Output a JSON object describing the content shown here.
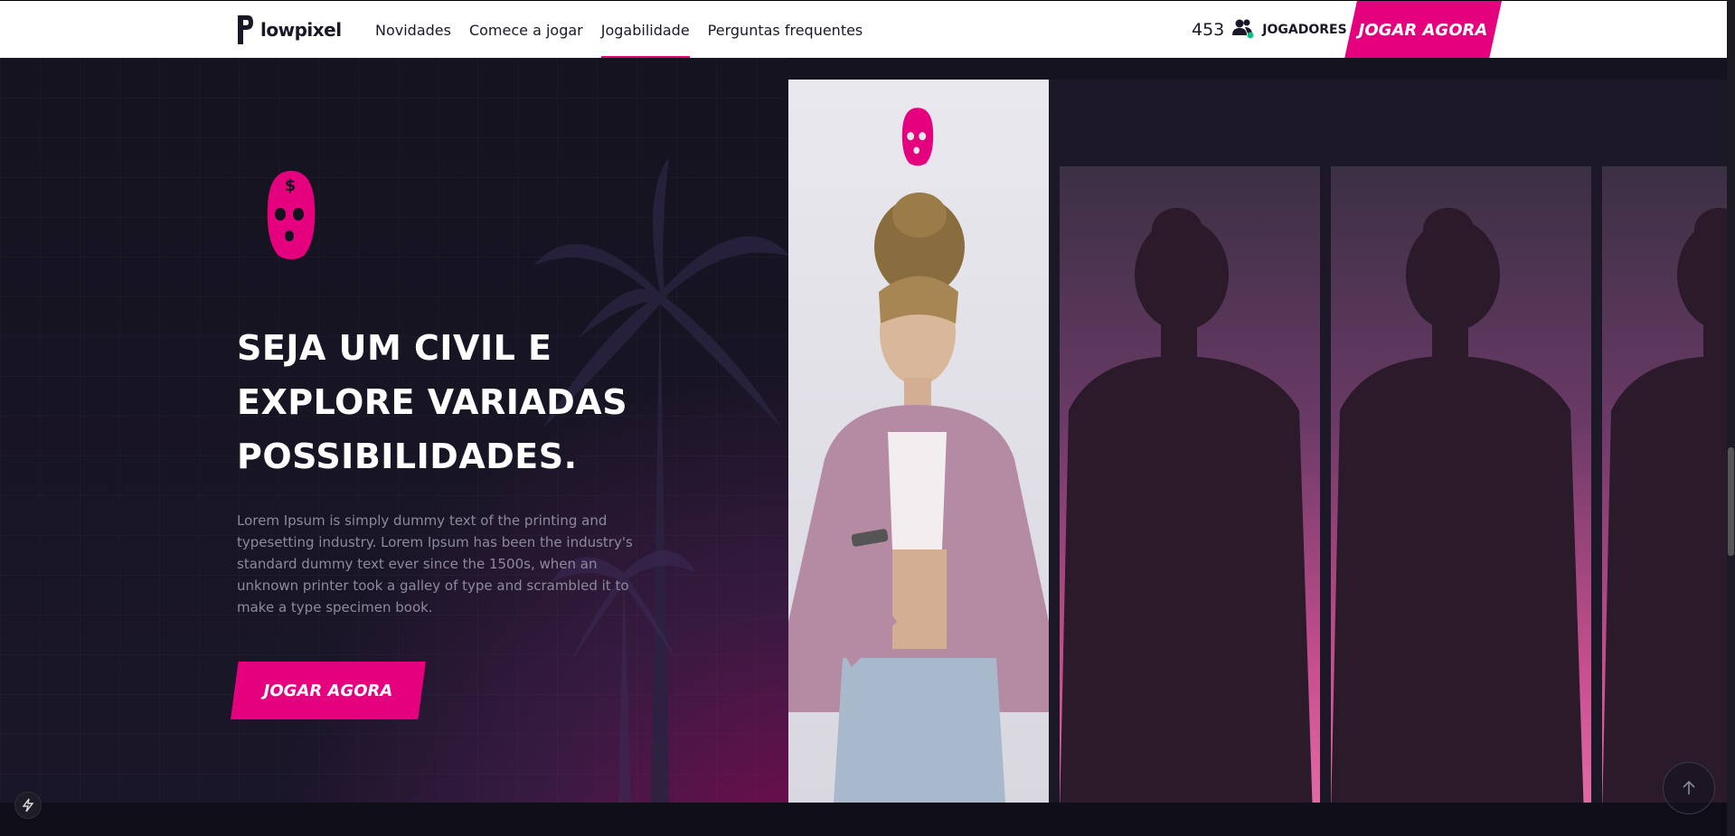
{
  "header": {
    "logo_text": "lowpixel",
    "nav": [
      {
        "label": "Novidades"
      },
      {
        "label": "Comece a jogar"
      },
      {
        "label": "Jogabilidade",
        "active": true
      },
      {
        "label": "Perguntas frequentes"
      }
    ],
    "players_count": "453",
    "players_label": "JOGADORES",
    "cta_label": "JOGAR AGORA"
  },
  "hero": {
    "title_lines": [
      "SEJA UM CIVIL E",
      "EXPLORE VARIADAS",
      "POSSIBILIDADES."
    ],
    "description": "Lorem Ipsum is simply dummy text of the printing and typesetting industry. Lorem Ipsum has been the industry's standard dummy text ever since the 1500s, when an unknown printer took a galley of type and scrambled it to make a type specimen book.",
    "cta_label": "JOGAR AGORA"
  },
  "colors": {
    "accent": "#e5007d",
    "background": "#14121f",
    "online": "#10c080"
  },
  "icons": [
    "logo-icon",
    "players-icon",
    "mask-icon",
    "palm-tree-icon",
    "bolt-icon",
    "arrow-up-icon"
  ]
}
